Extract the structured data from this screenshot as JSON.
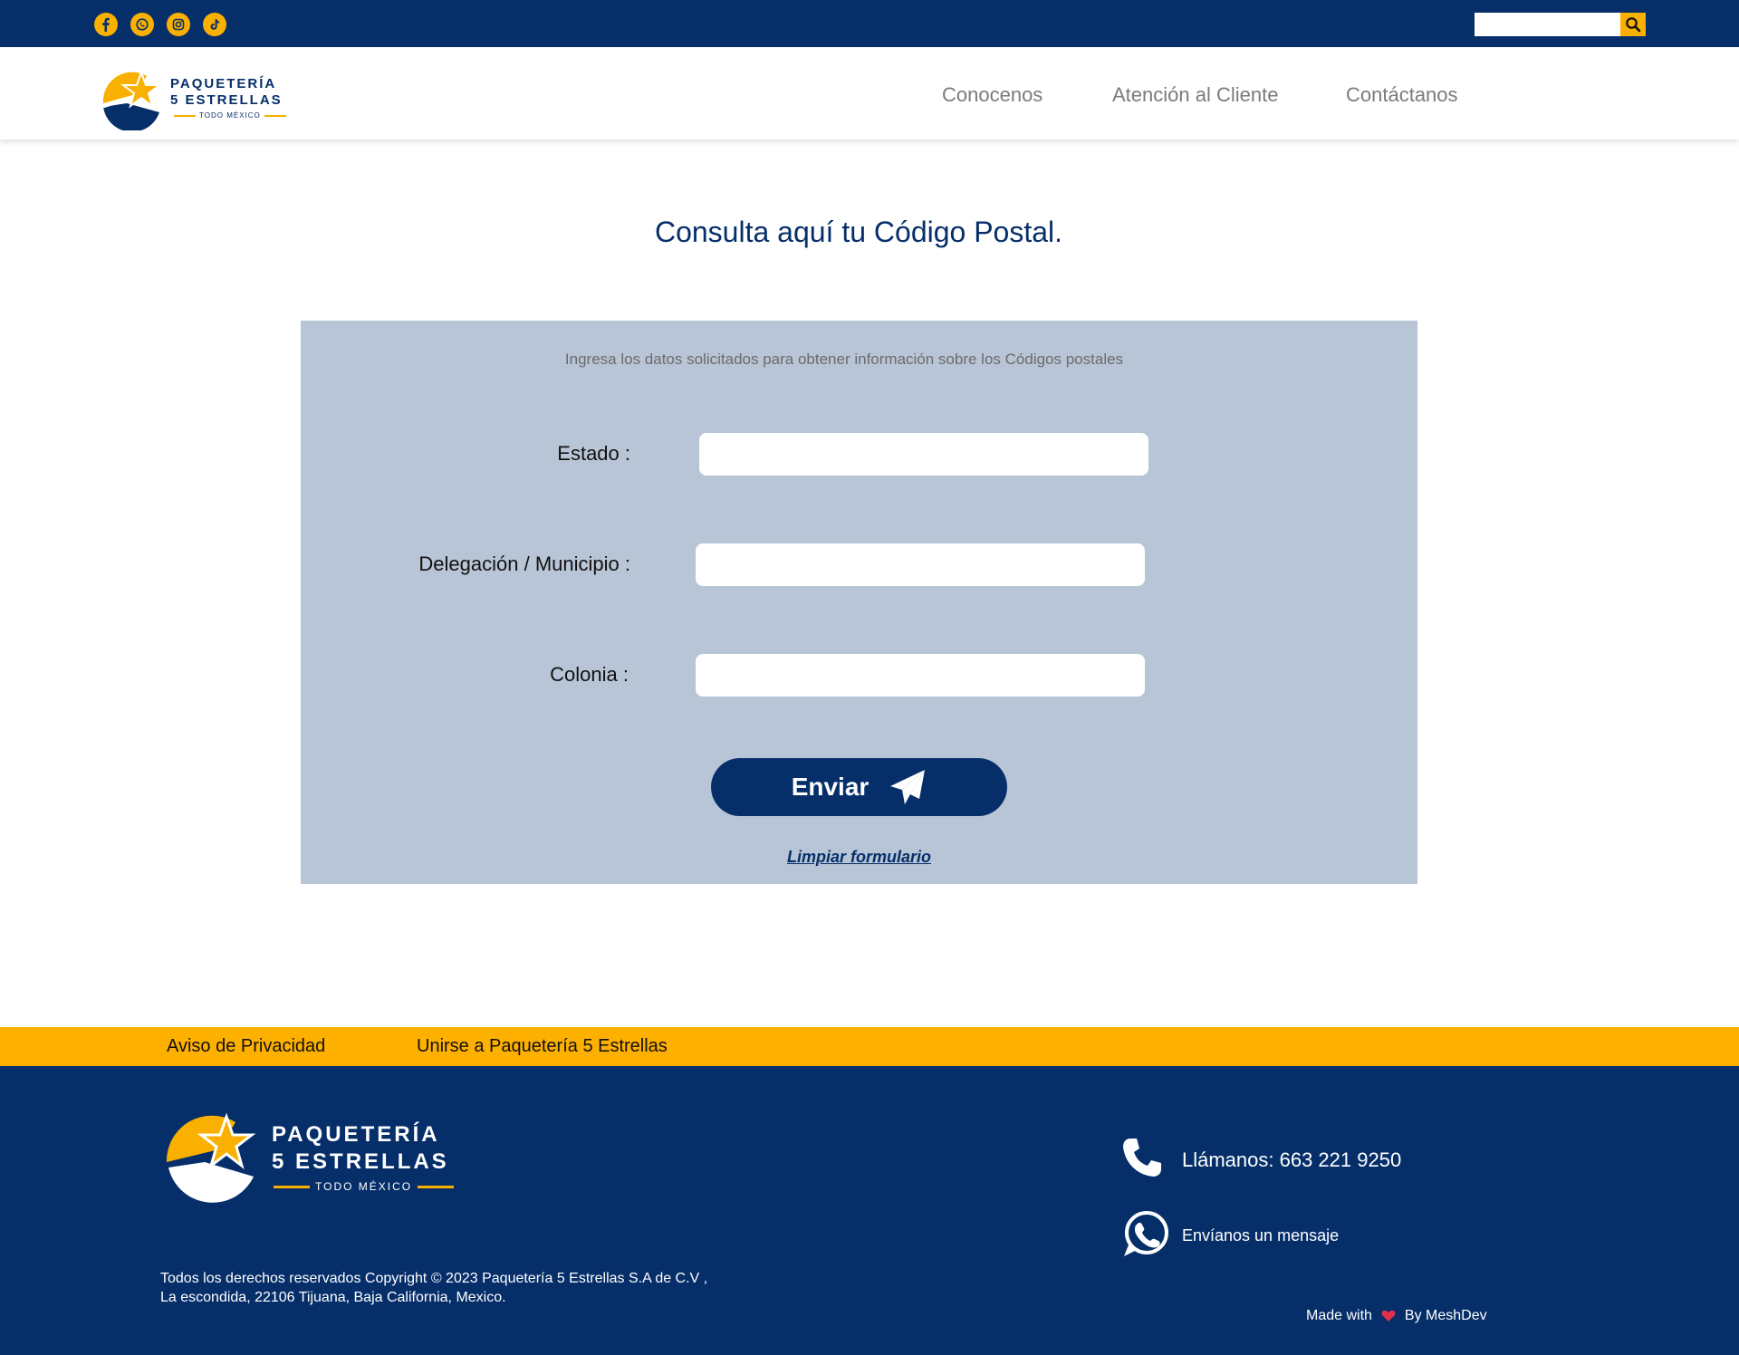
{
  "topbar": {
    "social": [
      {
        "name": "facebook-icon"
      },
      {
        "name": "whatsapp-icon"
      },
      {
        "name": "instagram-icon"
      },
      {
        "name": "tiktok-icon"
      }
    ],
    "search": {
      "value": "",
      "placeholder": ""
    }
  },
  "header": {
    "logo": {
      "line1": "PAQUETERÍA",
      "line2": "5 ESTRELLAS",
      "tagline": "TODO MÉXICO"
    },
    "nav": [
      "Conocenos",
      "Atención al Cliente",
      "Contáctanos"
    ]
  },
  "main": {
    "title": "Consulta aquí tu Código Postal.",
    "form": {
      "subtitle": "Ingresa los datos solicitados para obtener información sobre los Códigos postales",
      "fields": [
        {
          "label": "Estado :",
          "value": ""
        },
        {
          "label": "Delegación / Municipio :",
          "value": ""
        },
        {
          "label": "Colonia :",
          "value": ""
        }
      ],
      "submit_label": "Enviar",
      "clear_label": "Limpiar formulario"
    }
  },
  "yellowbar": {
    "links": [
      "Aviso de Privacidad",
      "Unirse a Paquetería 5 Estrellas"
    ]
  },
  "footer": {
    "logo": {
      "line1": "PAQUETERÍA",
      "line2": "5 ESTRELLAS",
      "tagline": "TODO MÉXICO"
    },
    "copyright_line1": "Todos los derechos reservados Copyright © 2023 Paquetería 5  Estrellas S.A de C.V ,",
    "copyright_line2": "La escondida, 22106 Tijuana, Baja California, Mexico.",
    "phone_text": "Llámanos: 663 221 9250",
    "whatsapp_text": "Envíanos un mensaje",
    "made_with": "Made with",
    "by": "By MeshDev"
  },
  "colors": {
    "navy": "#062f6a",
    "yellow": "#f9b000",
    "panel": "#b8c5d6"
  }
}
